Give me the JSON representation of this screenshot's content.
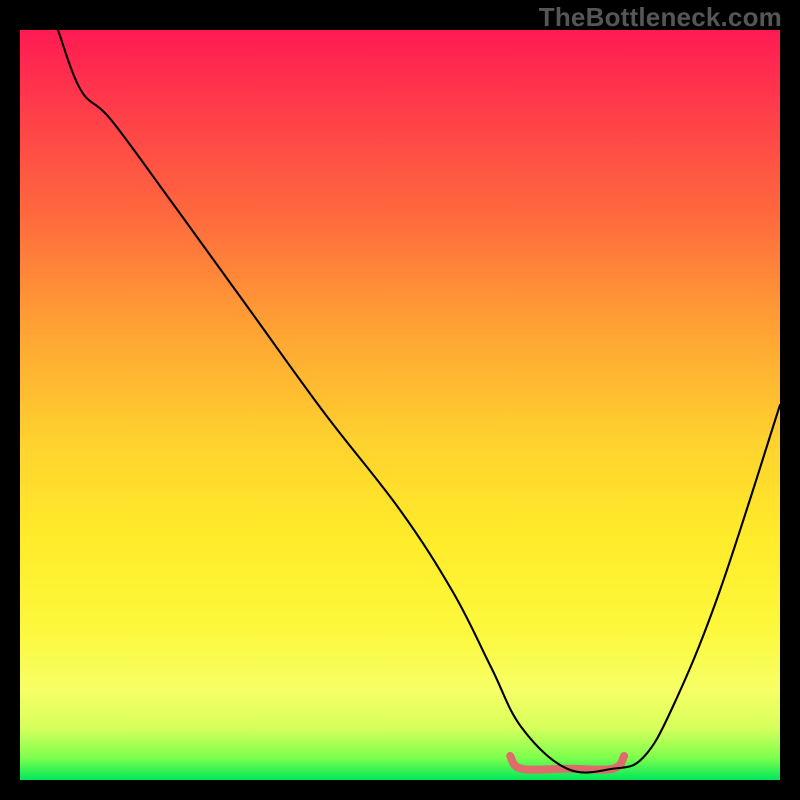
{
  "watermark": "TheBottleneck.com",
  "chart_data": {
    "type": "line",
    "title": "",
    "xlabel": "",
    "ylabel": "",
    "xlim": [
      0,
      100
    ],
    "ylim": [
      0,
      100
    ],
    "grid": false,
    "legend": false,
    "series": [
      {
        "name": "main-curve",
        "color": "#000000",
        "x": [
          5,
          8,
          12,
          20,
          30,
          40,
          50,
          57,
          62,
          66,
          72,
          78,
          82,
          86,
          92,
          100
        ],
        "y": [
          100,
          92,
          88,
          77,
          63,
          49,
          36,
          25,
          15,
          7,
          1.5,
          1.5,
          3,
          10,
          25,
          50
        ]
      },
      {
        "name": "accent-segment",
        "color": "#e06b6b",
        "x": [
          64.5,
          66,
          72,
          78,
          79.5
        ],
        "y": [
          3.2,
          1.5,
          1.5,
          1.5,
          3.2
        ]
      }
    ],
    "background_gradient_stops": [
      {
        "pos": 0,
        "color": "#ff1a52"
      },
      {
        "pos": 25,
        "color": "#ff6a3d"
      },
      {
        "pos": 55,
        "color": "#ffd22e"
      },
      {
        "pos": 88,
        "color": "#f6ff66"
      },
      {
        "pos": 100,
        "color": "#00e85a"
      }
    ]
  }
}
